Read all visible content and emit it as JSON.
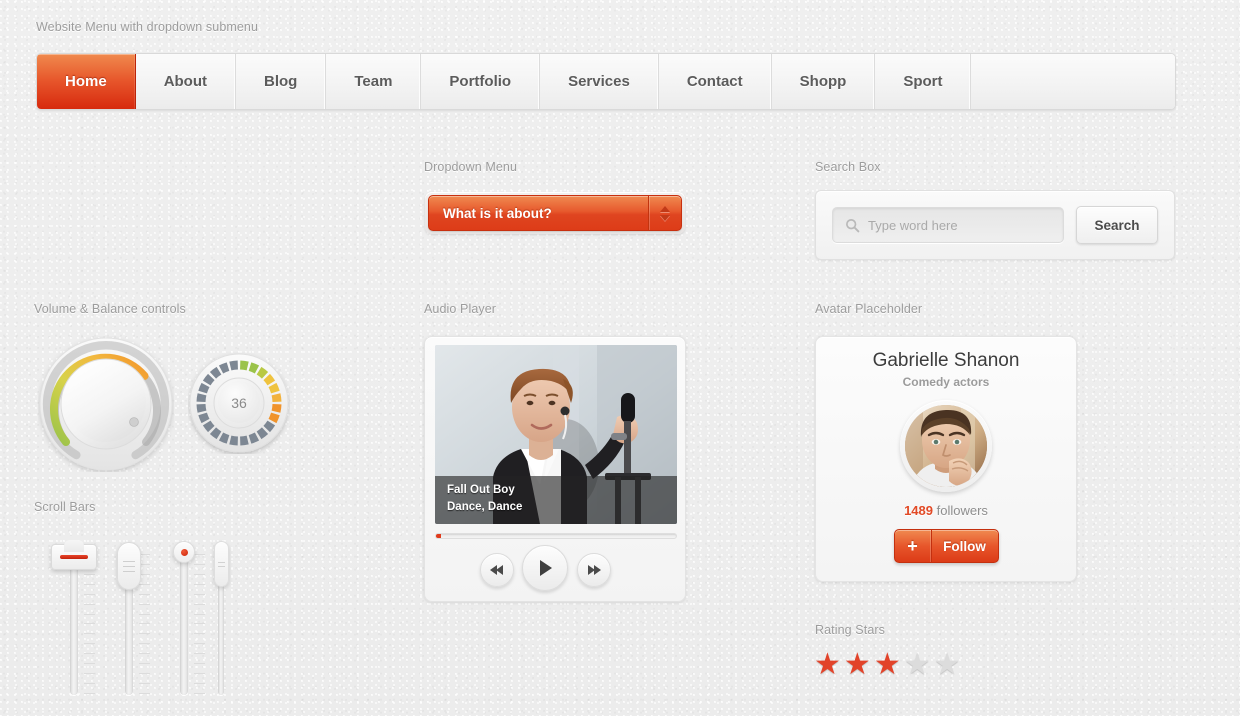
{
  "sections": {
    "menu_label": "Website Menu with dropdown submenu",
    "dropdown_label": "Dropdown Menu",
    "search_label": "Search Box",
    "knobs_label": "Volume & Balance controls",
    "player_label": "Audio Player",
    "avatar_label": "Avatar Placeholder",
    "scrollbars_label": "Scroll Bars",
    "rating_label": "Rating Stars"
  },
  "nav": {
    "active_index": 0,
    "items": [
      {
        "label": "Home"
      },
      {
        "label": "About"
      },
      {
        "label": "Blog"
      },
      {
        "label": "Team"
      },
      {
        "label": "Portfolio"
      },
      {
        "label": "Services"
      },
      {
        "label": "Contact"
      },
      {
        "label": "Shopp"
      },
      {
        "label": "Sport"
      }
    ]
  },
  "dropdown": {
    "selected": "What is it about?",
    "spinner_icon": "up-down-arrows-icon"
  },
  "search": {
    "value": "",
    "placeholder": "Type word here",
    "button_label": "Search",
    "icon": "search-icon"
  },
  "knobs": {
    "volume": {
      "name": "volume-knob",
      "value": 70
    },
    "balance": {
      "name": "balance-knob",
      "value": "36",
      "value_number": 36
    }
  },
  "player": {
    "artist": "Fall Out Boy",
    "track": "Dance, Dance",
    "progress_percent": 2,
    "controls": {
      "rewind": "rewind-icon",
      "play": "play-icon",
      "forward": "fast-forward-icon"
    }
  },
  "avatar": {
    "name": "Gabrielle Shanon",
    "role": "Comedy actors",
    "followers_count": "1489",
    "followers_word": "followers",
    "follow_plus": "+",
    "follow_label": "Follow"
  },
  "rating": {
    "max": 5,
    "value": 3,
    "glyph": "★"
  },
  "sliders": [
    {
      "name": "slider-handle-red-bar",
      "value_percent": 96
    },
    {
      "name": "slider-handle-grip-large",
      "value_percent": 90
    },
    {
      "name": "slider-handle-red-dot",
      "value_percent": 95
    },
    {
      "name": "slider-handle-narrow",
      "value_percent": 88
    }
  ],
  "colors": {
    "accent_red": "#e2432a",
    "accent_orange": "#f08a50",
    "text_muted": "#9d9d9d",
    "knob_green": "#9bc34a",
    "knob_yellow": "#efc33f",
    "knob_orange": "#f0932b",
    "knob_grey": "#7d8793"
  }
}
